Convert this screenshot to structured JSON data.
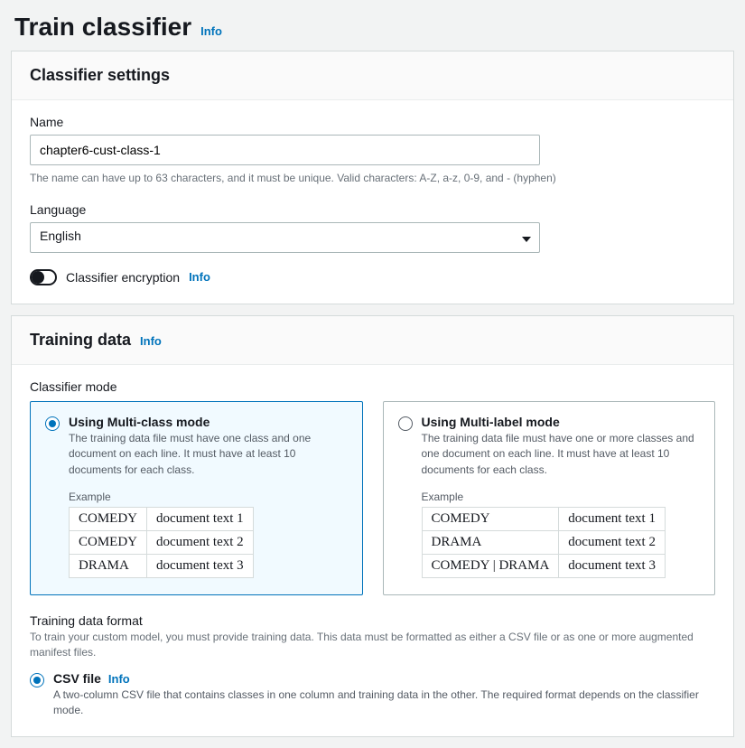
{
  "page": {
    "title": "Train classifier",
    "info": "Info"
  },
  "settings": {
    "header": "Classifier settings",
    "name_label": "Name",
    "name_value": "chapter6-cust-class-1",
    "name_help": "The name can have up to 63 characters, and it must be unique. Valid characters: A-Z, a-z, 0-9, and - (hyphen)",
    "language_label": "Language",
    "language_value": "English",
    "encryption_label": "Classifier encryption",
    "encryption_info": "Info"
  },
  "training": {
    "header": "Training data",
    "info": "Info",
    "mode_label": "Classifier mode",
    "modes": {
      "multiclass": {
        "title": "Using Multi-class mode",
        "desc": "The training data file must have one class and one document on each line. It must have at least 10 documents for each class.",
        "example_label": "Example",
        "rows": [
          [
            "COMEDY",
            "document text 1"
          ],
          [
            "COMEDY",
            "document text 2"
          ],
          [
            "DRAMA",
            "document text 3"
          ]
        ]
      },
      "multilabel": {
        "title": "Using Multi-label mode",
        "desc": "The training data file must have one or more classes and one document on each line. It must have at least 10 documents for each class.",
        "example_label": "Example",
        "rows": [
          [
            "COMEDY",
            "document text 1"
          ],
          [
            "DRAMA",
            "document text 2"
          ],
          [
            "COMEDY | DRAMA",
            "document text 3"
          ]
        ]
      }
    },
    "format": {
      "label": "Training data format",
      "help": "To train your custom model, you must provide training data. This data must be formatted as either a CSV file or as one or more augmented manifest files.",
      "csv": {
        "title": "CSV file",
        "info": "Info",
        "desc": "A two-column CSV file that contains classes in one column and training data in the other. The required format depends on the classifier mode."
      }
    }
  }
}
